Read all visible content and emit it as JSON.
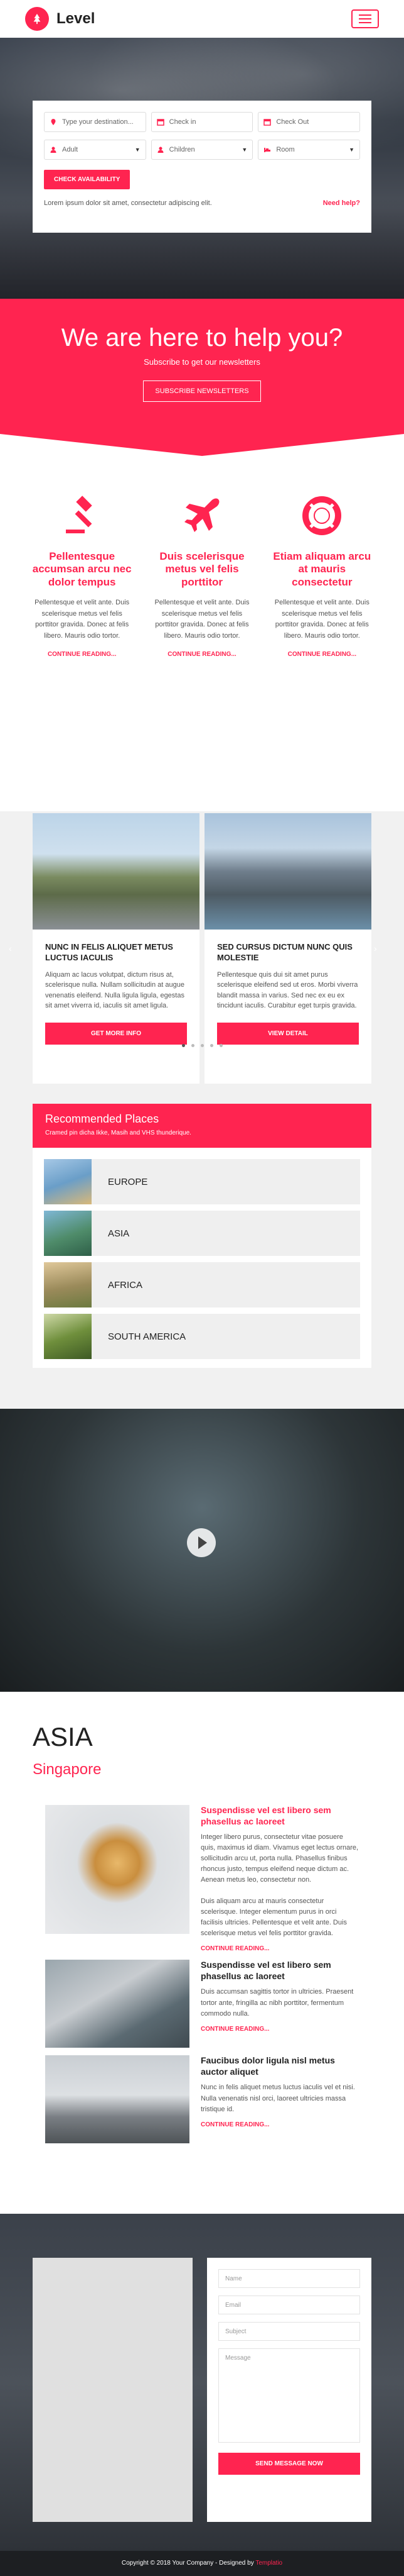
{
  "brand": {
    "name": "Level"
  },
  "search": {
    "destination_placeholder": "Type your destination...",
    "checkin_placeholder": "Check in",
    "checkout_placeholder": "Check Out",
    "adult": "Adult",
    "children": "Children",
    "room": "Room",
    "check_btn": "CHECK AVAILABILITY",
    "note": "Lorem ipsum dolor sit amet, consectetur adipiscing elit.",
    "help": "Need help?"
  },
  "newsletter": {
    "heading": "We are here to help you?",
    "sub": "Subscribe to get our newsletters",
    "button": "SUBSCRIBE NEWSLETTERS"
  },
  "features": [
    {
      "icon": "gavel-icon",
      "title": "Pellentesque accumsan arcu nec dolor tempus",
      "text": "Pellentesque et velit ante. Duis scelerisque metus vel felis porttitor gravida. Donec at felis libero. Mauris odio tortor.",
      "link": "CONTINUE READING..."
    },
    {
      "icon": "airplane-icon",
      "title": "Duis scelerisque metus vel felis porttitor",
      "text": "Pellentesque et velit ante. Duis scelerisque metus vel felis porttitor gravida. Donec at felis libero. Mauris odio tortor.",
      "link": "CONTINUE READING..."
    },
    {
      "icon": "lifebuoy-icon",
      "title": "Etiam aliquam arcu at mauris consectetur",
      "text": "Pellentesque et velit ante. Duis scelerisque metus vel felis porttitor gravida. Donec at felis libero. Mauris odio tortor.",
      "link": "CONTINUE READING..."
    }
  ],
  "slides": [
    {
      "title": "NUNC IN FELIS ALIQUET METUS LUCTUS IACULIS",
      "text": "Aliquam ac lacus volutpat, dictum risus at, scelerisque nulla. Nullam sollicitudin at augue venenatis eleifend. Nulla ligula ligula, egestas sit amet viverra id, iaculis sit amet ligula.",
      "button": "GET MORE INFO"
    },
    {
      "title": "SED CURSUS DICTUM NUNC QUIS MOLESTIE",
      "text": "Pellentesque quis dui sit amet purus scelerisque eleifend sed ut eros. Morbi viverra blandit massa in varius. Sed nec ex eu ex tincidunt iaculis. Curabitur eget turpis gravida.",
      "button": "VIEW DETAIL"
    }
  ],
  "recommended": {
    "title": "Recommended Places",
    "sub": "Cramed pin dicha Ikke, Masih and VHS thunderique.",
    "items": [
      "EUROPE",
      "ASIA",
      "AFRICA",
      "SOUTH AMERICA"
    ]
  },
  "asia": {
    "region": "ASIA",
    "city": "Singapore",
    "posts": [
      {
        "title": "Suspendisse vel est libero sem phasellus ac laoreet",
        "text": "Integer libero purus, consectetur vitae posuere quis, maximus id diam. Vivamus eget lectus ornare, sollicitudin arcu ut, porta nulla. Phasellus finibus rhoncus justo, tempus eleifend neque dictum ac. Aenean metus leo, consectetur non.\n\nDuis aliquam arcu at mauris consectetur scelerisque. Integer elementum purus in orci facilisis ultricies. Pellentesque et velit ante. Duis scelerisque metus vel felis porttitor gravida.",
        "link": "CONTINUE READING..."
      },
      {
        "title": "Suspendisse vel est libero sem phasellus ac laoreet",
        "text": "Duis accumsan sagittis tortor in ultricies. Praesent tortor ante, fringilla ac nibh porttitor, fermentum commodo nulla.",
        "link": "CONTINUE READING..."
      },
      {
        "title": "Faucibus dolor ligula nisl metus auctor aliquet",
        "text": "Nunc in felis aliquet metus luctus iaculis vel et nisi. Nulla venenatis nisl orci, laoreet ultricies massa tristique id.",
        "link": "CONTINUE READING..."
      }
    ]
  },
  "contact": {
    "name_ph": "Name",
    "email_ph": "Email",
    "subject_ph": "Subject",
    "message_ph": "Message",
    "send": "SEND MESSAGE NOW"
  },
  "footer": {
    "text": "Copyright © 2018 Your Company - Designed by",
    "credit": "Templatio"
  },
  "colors": {
    "accent": "#ff2450"
  }
}
